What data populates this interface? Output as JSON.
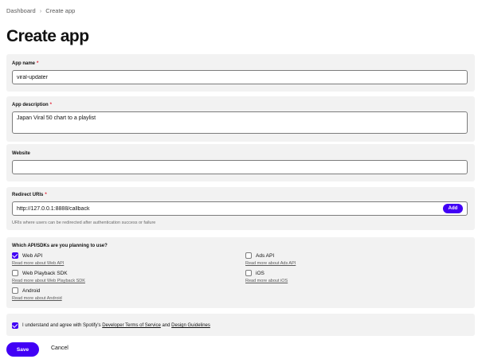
{
  "breadcrumb": {
    "parent": "Dashboard",
    "separator": "›",
    "current": "Create app"
  },
  "page_title": "Create app",
  "required_marker": "*",
  "app_name": {
    "label": "App name",
    "value": "viral-updater"
  },
  "app_description": {
    "label": "App description",
    "value": "Japan Viral 50 chart to a playlist"
  },
  "website": {
    "label": "Website",
    "value": ""
  },
  "redirect_uris": {
    "label": "Redirect URIs",
    "value": "http://127.0.0.1:8888/callback",
    "add_label": "Add",
    "helper": "URIs where users can be redirected after authentication success or failure"
  },
  "apis": {
    "question": "Which API/SDKs are you planning to use?",
    "options": [
      {
        "label": "Web API",
        "link": "Read more about Web API",
        "checked": true
      },
      {
        "label": "Ads API",
        "link": "Read more about Ads API",
        "checked": false
      },
      {
        "label": "Web Playback SDK",
        "link": "Read more about Web Playback SDK",
        "checked": false
      },
      {
        "label": "iOS",
        "link": "Read more about iOS",
        "checked": false
      },
      {
        "label": "Android",
        "link": "Read more about Android",
        "checked": false
      }
    ]
  },
  "agreement": {
    "checked": true,
    "prefix": "I understand and agree with Spotify's",
    "terms_link": "Developer Terms of Service",
    "conjunction": "and",
    "guidelines_link": "Design Guidelines"
  },
  "actions": {
    "save_label": "Save",
    "cancel_label": "Cancel"
  },
  "colors": {
    "accent": "#4100f5",
    "panel_bg": "#f2f2f2",
    "required": "#e22134"
  }
}
